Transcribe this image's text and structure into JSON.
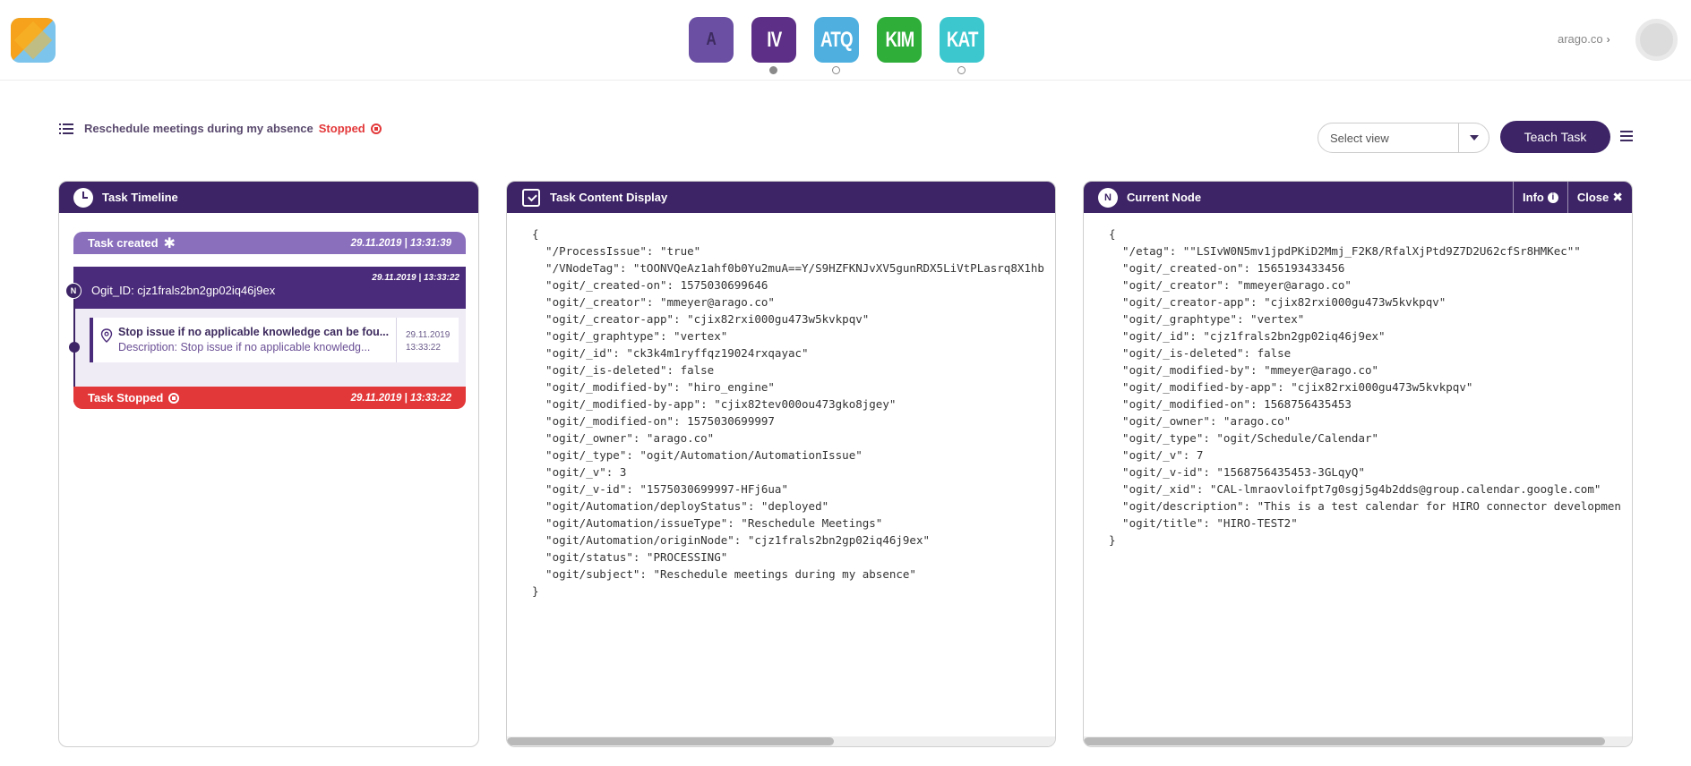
{
  "topbar": {
    "apps": [
      {
        "label": "A",
        "color": "#6a4fa3",
        "dot": false
      },
      {
        "label": "IV",
        "color": "#5d2f86",
        "dot": true,
        "dot_filled": true
      },
      {
        "label": "ATQ",
        "color": "#4fb0e0",
        "dot": true,
        "dot_filled": false
      },
      {
        "label": "KIM",
        "color": "#2fae3a",
        "dot": false
      },
      {
        "label": "KAT",
        "color": "#3cc7cf",
        "dot": true,
        "dot_filled": false
      }
    ],
    "org_label": "arago.co",
    "org_chevron": "›"
  },
  "task": {
    "name": "Reschedule meetings during my absence",
    "status": "Stopped"
  },
  "toolbar": {
    "select_view_placeholder": "Select view",
    "teach_label": "Teach Task"
  },
  "panels": {
    "timeline_title": "Task Timeline",
    "content_title": "Task Content Display",
    "node_title": "Current Node",
    "info_label": "Info",
    "close_label": "Close"
  },
  "timeline": {
    "created_label": "Task created",
    "created_date": "29.11.2019 | 13:31:39",
    "node_badge": "N",
    "node_id": "Ogit_ID: cjz1frals2bn2gp02iq46j9ex",
    "node_date": "29.11.2019 | 13:33:22",
    "issue_title": "Stop issue if no applicable knowledge can be fou...",
    "issue_desc": "Description: Stop issue if no applicable knowledg...",
    "issue_date_1": "29.11.2019",
    "issue_date_2": "13:33:22",
    "stopped_label": "Task Stopped",
    "stopped_date": "29.11.2019 | 13:33:22"
  },
  "content_json": "{\n  \"/ProcessIssue\": \"true\"\n  \"/VNodeTag\": \"tOONVQeAz1ahf0b0Yu2muA==Y/S9HZFKNJvXV5gunRDX5LiVtPLasrq8X1hb\n  \"ogit/_created-on\": 1575030699646\n  \"ogit/_creator\": \"mmeyer@arago.co\"\n  \"ogit/_creator-app\": \"cjix82rxi000gu473w5kvkpqv\"\n  \"ogit/_graphtype\": \"vertex\"\n  \"ogit/_id\": \"ck3k4m1ryffqz19024rxqayac\"\n  \"ogit/_is-deleted\": false\n  \"ogit/_modified-by\": \"hiro_engine\"\n  \"ogit/_modified-by-app\": \"cjix82tev000ou473gko8jgey\"\n  \"ogit/_modified-on\": 1575030699997\n  \"ogit/_owner\": \"arago.co\"\n  \"ogit/_type\": \"ogit/Automation/AutomationIssue\"\n  \"ogit/_v\": 3\n  \"ogit/_v-id\": \"1575030699997-HFj6ua\"\n  \"ogit/Automation/deployStatus\": \"deployed\"\n  \"ogit/Automation/issueType\": \"Reschedule Meetings\"\n  \"ogit/Automation/originNode\": \"cjz1frals2bn2gp02iq46j9ex\"\n  \"ogit/status\": \"PROCESSING\"\n  \"ogit/subject\": \"Reschedule meetings during my absence\"\n}",
  "node_json": "{\n  \"/etag\": \"\"LSIvW0N5mv1jpdPKiD2Mmj_F2K8/RfalXjPtd9Z7D2U62cfSr8HMKec\"\"\n  \"ogit/_created-on\": 1565193433456\n  \"ogit/_creator\": \"mmeyer@arago.co\"\n  \"ogit/_creator-app\": \"cjix82rxi000gu473w5kvkpqv\"\n  \"ogit/_graphtype\": \"vertex\"\n  \"ogit/_id\": \"cjz1frals2bn2gp02iq46j9ex\"\n  \"ogit/_is-deleted\": false\n  \"ogit/_modified-by\": \"mmeyer@arago.co\"\n  \"ogit/_modified-by-app\": \"cjix82rxi000gu473w5kvkpqv\"\n  \"ogit/_modified-on\": 1568756435453\n  \"ogit/_owner\": \"arago.co\"\n  \"ogit/_type\": \"ogit/Schedule/Calendar\"\n  \"ogit/_v\": 7\n  \"ogit/_v-id\": \"1568756435453-3GLqyQ\"\n  \"ogit/_xid\": \"CAL-lmraovloifpt7g0sgj5g4b2dds@group.calendar.google.com\"\n  \"ogit/description\": \"This is a test calendar for HIRO connector developmen\n  \"ogit/title\": \"HIRO-TEST2\"\n}",
  "colors": {
    "brand_purple": "#3d2466",
    "stopped_red": "#e3383a",
    "created_purple": "#8a6fbd"
  },
  "icons": [
    "list-icon",
    "stop-icon",
    "clock-icon",
    "checkbox-icon",
    "node-icon",
    "info-icon",
    "close-icon",
    "pin-icon",
    "asterisk-icon",
    "menu-icon"
  ]
}
